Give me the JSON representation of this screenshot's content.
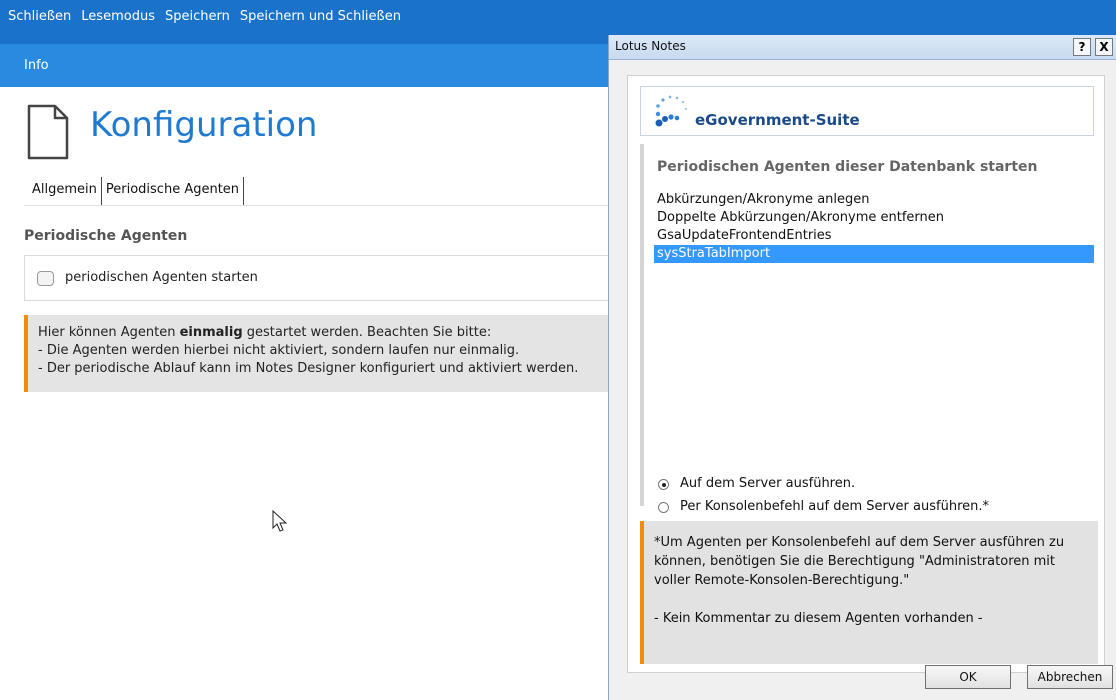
{
  "app": {
    "menu": [
      "Schließen",
      "Lesemodus",
      "Speichern",
      "Speichern und Schließen"
    ],
    "info_label": "Info",
    "page_title": "Konfiguration",
    "tabs": [
      "Allgemein",
      "Periodische Agenten"
    ],
    "section_title": "Periodische Agenten",
    "checkbox_label": "periodischen Agenten starten",
    "checkbox_checked": false,
    "note": {
      "line1_pre": "Hier können Agenten ",
      "line1_bold": "einmalig",
      "line1_post": " gestartet werden. Beachten Sie bitte:",
      "line2": "- Die Agenten werden hierbei nicht aktiviert, sondern laufen nur einmalig.",
      "line3": "- Der periodische Ablauf kann im Notes Designer konfiguriert und aktiviert werden."
    }
  },
  "dialog": {
    "window_title": "Lotus Notes",
    "help_button": "?",
    "close_button": "X",
    "brand": "eGovernment-Suite",
    "list_title": "Periodischen Agenten dieser Datenbank starten",
    "agents": [
      "Abkürzungen/Akronyme anlegen",
      "Doppelte Abkürzungen/Akronyme entfernen",
      "GsaUpdateFrontendEntries",
      "sysStraTabImport"
    ],
    "selected_agent": "sysStraTabImport",
    "radio_options": [
      "Auf dem Server ausführen.",
      "Per Konsolenbefehl auf dem Server ausführen.*"
    ],
    "selected_radio": "Auf dem Server ausführen.",
    "note_paragraph": "*Um Agenten per Konsolenbefehl auf dem Server ausführen zu können, benötigen Sie die Berechtigung \"Administratoren mit voller Remote-Konsolen-Berechtigung.\"",
    "note_comment": "- Kein Kommentar zu diesem Agenten vorhanden -",
    "ok_label": "OK",
    "cancel_label": "Abbrechen"
  },
  "colors": {
    "topbar": "#1a73c8",
    "infobar": "#2a8ae0",
    "title_blue": "#1f7ad0",
    "selection": "#3399ff",
    "note_accent": "#f28c0f"
  }
}
